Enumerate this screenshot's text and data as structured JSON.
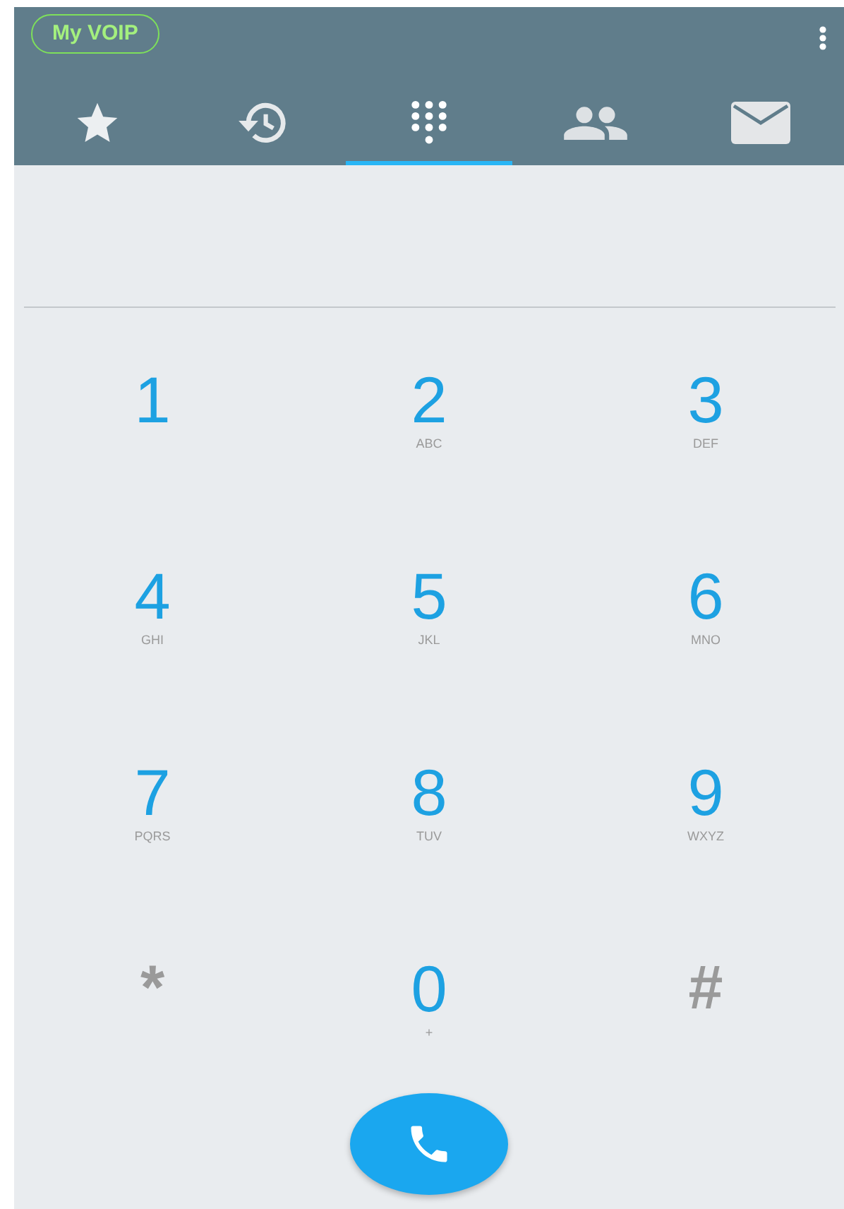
{
  "header": {
    "account": "My VOIP"
  },
  "tabs": [
    {
      "kind": "star",
      "selected": false
    },
    {
      "kind": "history",
      "selected": false
    },
    {
      "kind": "dialpad",
      "selected": true
    },
    {
      "kind": "people",
      "selected": false
    },
    {
      "kind": "mail",
      "selected": false
    }
  ],
  "keys": [
    {
      "kind": "digit",
      "label": "1"
    },
    {
      "kind": "digit",
      "label": "2",
      "letters": "ABC"
    },
    {
      "kind": "digit",
      "label": "3",
      "letters": "DEF"
    },
    {
      "kind": "digit",
      "label": "4",
      "letters": "GHI"
    },
    {
      "kind": "digit",
      "label": "5",
      "letters": "JKL"
    },
    {
      "kind": "digit",
      "label": "6",
      "letters": "MNO"
    },
    {
      "kind": "digit",
      "label": "7",
      "letters": "PQRS"
    },
    {
      "kind": "digit",
      "label": "8",
      "letters": "TUV"
    },
    {
      "kind": "digit",
      "label": "9",
      "letters": "WXYZ"
    },
    {
      "kind": "symbol",
      "label": "*"
    },
    {
      "kind": "digit",
      "label": "0",
      "letters": "+"
    },
    {
      "kind": "symbol",
      "label": "#"
    }
  ]
}
